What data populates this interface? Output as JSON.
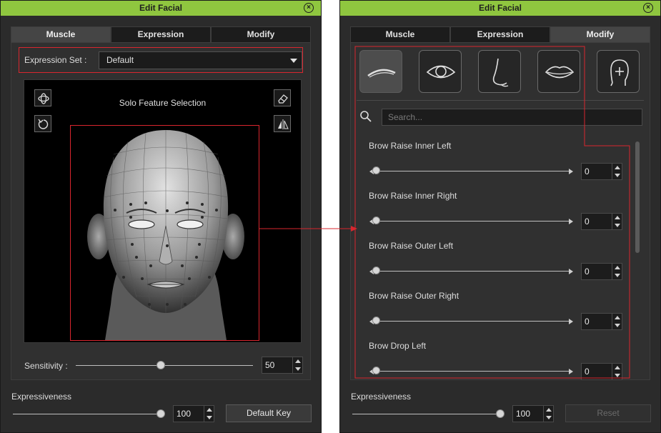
{
  "left_panel": {
    "title": "Edit Facial",
    "tabs": [
      {
        "label": "Muscle"
      },
      {
        "label": "Expression"
      },
      {
        "label": "Modify"
      }
    ],
    "expression_set": {
      "label": "Expression Set :",
      "value": "Default"
    },
    "viewport": {
      "solo_label": "Solo Feature Selection"
    },
    "sensitivity": {
      "label": "Sensitivity :",
      "value": "50",
      "level_percent": 48
    },
    "expressiveness": {
      "label": "Expressiveness",
      "value": "100",
      "level_percent": 100
    },
    "default_key_label": "Default Key"
  },
  "right_panel": {
    "title": "Edit Facial",
    "tabs": [
      {
        "label": "Muscle"
      },
      {
        "label": "Expression"
      },
      {
        "label": "Modify"
      }
    ],
    "feature_icons": [
      "brow-icon",
      "eye-icon",
      "nose-icon",
      "mouth-icon",
      "head-icon"
    ],
    "search": {
      "placeholder": "Search..."
    },
    "params": [
      {
        "name": "Brow Raise Inner Left",
        "value": "0"
      },
      {
        "name": "Brow Raise Inner Right",
        "value": "0"
      },
      {
        "name": "Brow Raise Outer Left",
        "value": "0"
      },
      {
        "name": "Brow Raise Outer Right",
        "value": "0"
      },
      {
        "name": "Brow Drop Left",
        "value": "0"
      }
    ],
    "expressiveness": {
      "label": "Expressiveness",
      "value": "100",
      "level_percent": 100
    },
    "reset_label": "Reset"
  },
  "colors": {
    "title_bar": "#8fc63f",
    "highlight": "#d9262e",
    "panel_bg": "#2b2b2b"
  }
}
